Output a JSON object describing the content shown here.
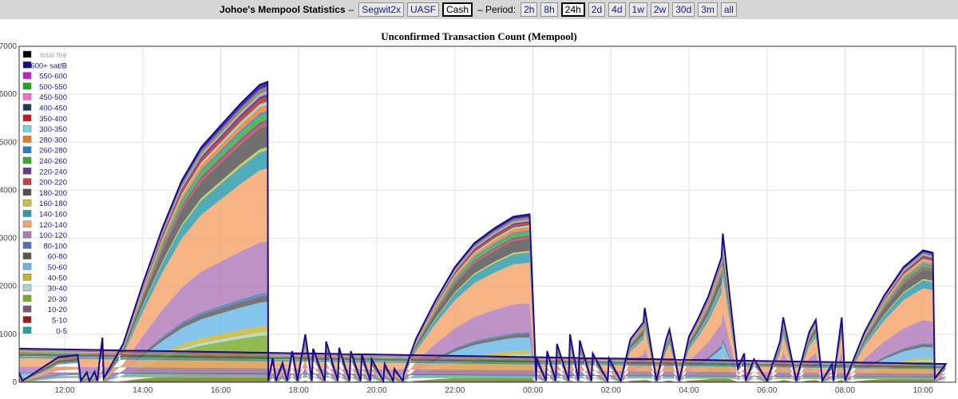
{
  "header": {
    "title": "Johoe's Mempool Statistics",
    "dash1": "–",
    "chains": [
      {
        "label": "Segwit2x",
        "active": false
      },
      {
        "label": "UASF",
        "active": false
      },
      {
        "label": "Cash",
        "active": true
      }
    ],
    "period_label": "– Period:",
    "periods": [
      {
        "label": "2h",
        "active": false
      },
      {
        "label": "8h",
        "active": false
      },
      {
        "label": "24h",
        "active": true
      },
      {
        "label": "2d",
        "active": false
      },
      {
        "label": "4d",
        "active": false
      },
      {
        "label": "1w",
        "active": false
      },
      {
        "label": "2w",
        "active": false
      },
      {
        "label": "30d",
        "active": false
      },
      {
        "label": "3m",
        "active": false
      },
      {
        "label": "all",
        "active": false
      }
    ]
  },
  "chart_data": {
    "type": "area",
    "stacked": true,
    "title": "Unconfirmed Transaction Count (Mempool)",
    "xlabel": "",
    "ylabel": "",
    "ylim": [
      0,
      7000
    ],
    "yticks": [
      0,
      1000,
      2000,
      3000,
      4000,
      5000,
      6000,
      7000
    ],
    "xlim": [
      "10:50",
      "10:50"
    ],
    "xticks": [
      "12:00",
      "14:00",
      "16:00",
      "18:00",
      "20:00",
      "22:00",
      "00:00",
      "02:00",
      "04:00",
      "06:00",
      "08:00",
      "10:00"
    ],
    "grid": true,
    "legend_position": "top-left",
    "outline_color": "#1a0a8c",
    "layer_colors": [
      "#2b9fa8",
      "#a01818",
      "#7a5a7a",
      "#7aab2a",
      "#a8d4d4",
      "#c8b428",
      "#6ab8e8",
      "#585858",
      "#4a72b8",
      "#b07ab8",
      "#f4a46a",
      "#2a9aa8",
      "#c8c040",
      "#505050",
      "#c84040",
      "#6a3a8a",
      "#3aa82a",
      "#2a7ac8",
      "#f07a1a",
      "#70d8d8",
      "#c81a1a",
      "#1a3a5a",
      "#f070c8",
      "#1aa81a",
      "#c81ac8",
      "#1a0a8c",
      "#000000"
    ],
    "legend": [
      {
        "label": "total fee",
        "color": "#000000",
        "muted": true
      },
      {
        "label": "600+ sat/B",
        "color": "#1a0a8c"
      },
      {
        "label": "550-600",
        "color": "#c81ac8"
      },
      {
        "label": "500-550",
        "color": "#1aa81a"
      },
      {
        "label": "450-500",
        "color": "#f070c8"
      },
      {
        "label": "400-450",
        "color": "#1a3a5a"
      },
      {
        "label": "350-400",
        "color": "#c81a1a"
      },
      {
        "label": "300-350",
        "color": "#70d8d8"
      },
      {
        "label": "280-300",
        "color": "#f07a1a"
      },
      {
        "label": "260-280",
        "color": "#2a7ac8"
      },
      {
        "label": "240-260",
        "color": "#3aa82a"
      },
      {
        "label": "220-240",
        "color": "#6a3a8a"
      },
      {
        "label": "200-220",
        "color": "#c84040"
      },
      {
        "label": "180-200",
        "color": "#505050"
      },
      {
        "label": "160-180",
        "color": "#c8c040"
      },
      {
        "label": "140-160",
        "color": "#2a9aa8"
      },
      {
        "label": "120-140",
        "color": "#f4a46a"
      },
      {
        "label": "100-120",
        "color": "#b07ab8"
      },
      {
        "label": "80-100",
        "color": "#4a72b8"
      },
      {
        "label": "60-80",
        "color": "#585858"
      },
      {
        "label": "50-60",
        "color": "#6ab8e8"
      },
      {
        "label": "40-50",
        "color": "#c8b428"
      },
      {
        "label": "30-40",
        "color": "#a8d4d4"
      },
      {
        "label": "20-30",
        "color": "#7aab2a"
      },
      {
        "label": "10-20",
        "color": "#7a5a7a"
      },
      {
        "label": "5-10",
        "color": "#a01818"
      },
      {
        "label": "0-5",
        "color": "#2b9fa8"
      }
    ],
    "total_series": {
      "name": "total",
      "x": [
        "10:50",
        "10:55",
        "11:50",
        "12:20",
        "12:25",
        "12:34",
        "12:38",
        "12:46",
        "12:50",
        "12:58",
        "13:00",
        "13:30",
        "14:00",
        "14:30",
        "15:00",
        "15:30",
        "16:00",
        "16:30",
        "17:00",
        "17:12",
        "17:13",
        "17:20",
        "17:25",
        "17:35",
        "17:42",
        "17:50",
        "17:58",
        "18:10",
        "18:20",
        "18:22",
        "18:40",
        "18:42",
        "19:00",
        "19:02",
        "19:18",
        "19:20",
        "19:35",
        "19:37",
        "19:50",
        "19:52",
        "20:10",
        "20:12",
        "20:25",
        "20:27",
        "20:40",
        "20:42",
        "21:00",
        "21:30",
        "22:00",
        "22:30",
        "23:00",
        "23:30",
        "23:55",
        "00:05",
        "00:06",
        "00:20",
        "00:22",
        "00:35",
        "00:37",
        "00:55",
        "00:57",
        "01:10",
        "01:12",
        "01:30",
        "01:32",
        "01:55",
        "01:57",
        "02:15",
        "02:30",
        "02:50",
        "02:52",
        "03:10",
        "03:25",
        "03:30",
        "03:45",
        "04:00",
        "04:15",
        "04:30",
        "04:40",
        "04:50",
        "04:52",
        "05:15",
        "05:25",
        "05:27",
        "05:40",
        "06:00",
        "06:20",
        "06:25",
        "06:45",
        "07:05",
        "07:15",
        "07:25",
        "07:40",
        "07:42",
        "07:55",
        "08:00",
        "08:30",
        "09:00",
        "09:30",
        "10:00",
        "10:15",
        "10:18",
        "10:35",
        "10:50"
      ],
      "y": [
        200,
        30,
        520,
        570,
        30,
        210,
        30,
        220,
        30,
        930,
        80,
        800,
        2050,
        3200,
        4200,
        4900,
        5350,
        5800,
        6200,
        6260,
        30,
        500,
        30,
        400,
        30,
        650,
        30,
        1000,
        30,
        700,
        30,
        850,
        30,
        720,
        30,
        650,
        30,
        580,
        30,
        480,
        30,
        380,
        30,
        280,
        30,
        200,
        900,
        1700,
        2400,
        2900,
        3200,
        3450,
        3500,
        30,
        500,
        30,
        650,
        30,
        800,
        30,
        1000,
        30,
        870,
        30,
        600,
        30,
        500,
        30,
        900,
        1250,
        1550,
        30,
        900,
        1100,
        30,
        950,
        1350,
        1800,
        2200,
        2600,
        3100,
        300,
        600,
        30,
        480,
        30,
        850,
        1350,
        30,
        1050,
        1300,
        30,
        380,
        30,
        1350,
        30,
        1050,
        1800,
        2400,
        2750,
        2700,
        80,
        380,
        700
      ]
    },
    "layers_note": "27 fee-rate bands stacked; proportions per band follow the legend order from 0-5 (bottom) to 600+ sat/B (top)",
    "band_shares": [
      0.005,
      0.01,
      0.02,
      0.12,
      0.01,
      0.02,
      0.08,
      0.02,
      0.01,
      0.17,
      0.24,
      0.06,
      0.01,
      0.07,
      0.01,
      0.01,
      0.02,
      0.01,
      0.02,
      0.01,
      0.015,
      0.01,
      0.01,
      0.01,
      0.005,
      0.015,
      0.0
    ]
  }
}
